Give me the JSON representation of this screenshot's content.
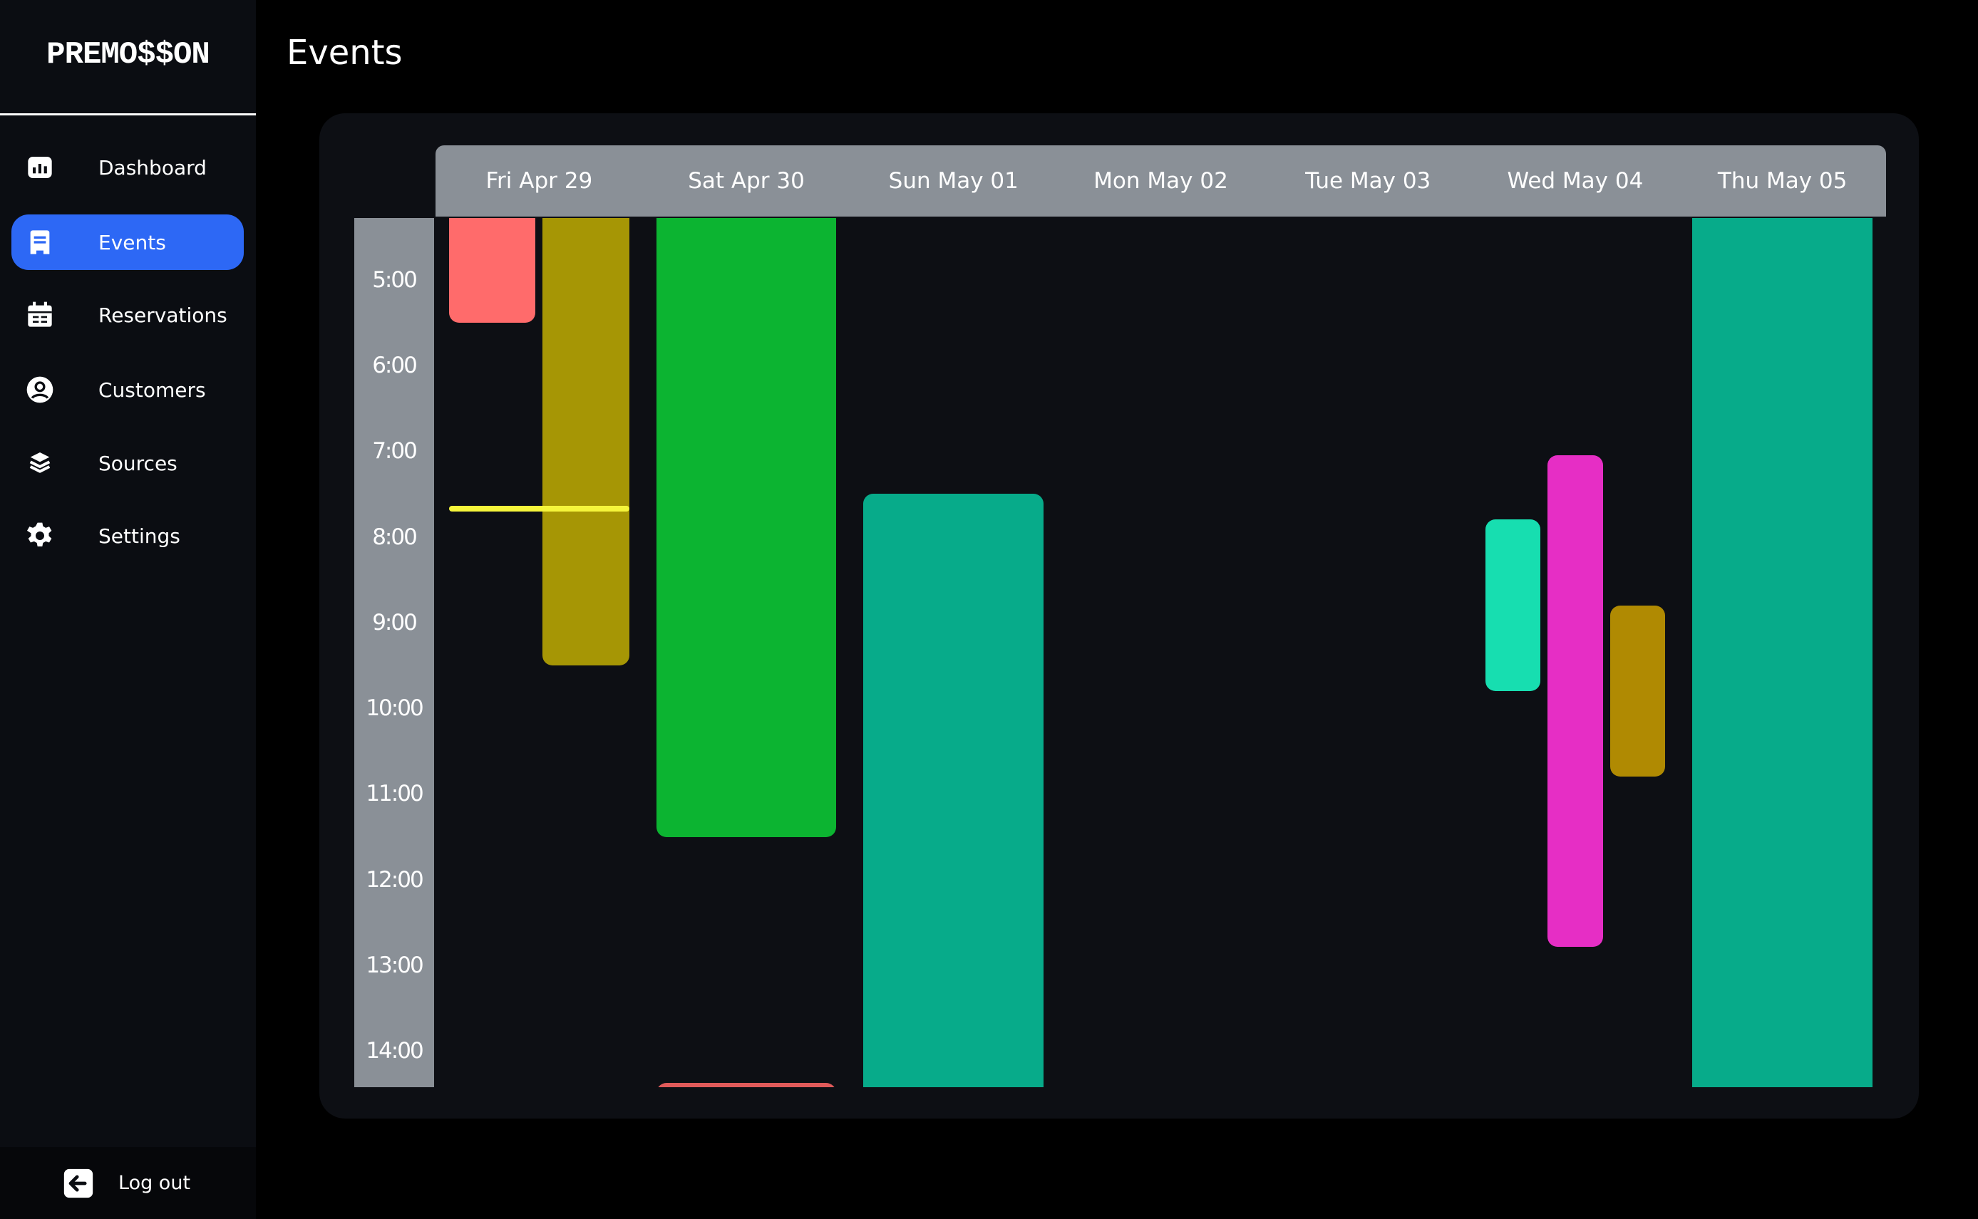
{
  "app": {
    "logo": "PREMO$$ON",
    "page_title": "Events"
  },
  "sidebar": {
    "items": [
      {
        "label": "Dashboard",
        "icon": "bar-chart-icon",
        "active": false
      },
      {
        "label": "Events",
        "icon": "events-icon",
        "active": true
      },
      {
        "label": "Reservations",
        "icon": "calendar-icon",
        "active": false
      },
      {
        "label": "Customers",
        "icon": "user-circle-icon",
        "active": false
      },
      {
        "label": "Sources",
        "icon": "layers-icon",
        "active": false
      },
      {
        "label": "Settings",
        "icon": "gear-icon",
        "active": false
      }
    ],
    "logout": "Log out"
  },
  "calendar": {
    "days": [
      "Fri Apr 29",
      "Sat Apr 30",
      "Sun May 01",
      "Mon May 02",
      "Tue May 03",
      "Wed May 04",
      "Thu May 05"
    ],
    "hours": [
      "5:00",
      "6:00",
      "7:00",
      "8:00",
      "9:00",
      "10:00",
      "11:00",
      "12:00",
      "13:00",
      "14:00"
    ],
    "visible_range_hours": [
      4.28,
      14.43
    ],
    "events": [
      {
        "day": 0,
        "start": 4.0,
        "end": 5.5,
        "color": "#ff6b6b",
        "lane": 0,
        "lanes": 2
      },
      {
        "day": 0,
        "start": 4.0,
        "end": 9.5,
        "color": "#a69605",
        "lane": 1,
        "lanes": 2
      },
      {
        "day": 1,
        "start": 4.0,
        "end": 11.5,
        "color": "#0cb431",
        "lane": 0,
        "lanes": 1
      },
      {
        "day": 1,
        "start": 14.37,
        "end": 15.5,
        "color": "#e05a5a",
        "lane": 0,
        "lanes": 1
      },
      {
        "day": 2,
        "start": 7.5,
        "end": 15.0,
        "color": "#07ab8a",
        "lane": 0,
        "lanes": 1
      },
      {
        "day": 5,
        "start": 7.8,
        "end": 9.8,
        "color": "#17deb0",
        "lane": 0,
        "lanes": 3
      },
      {
        "day": 5,
        "start": 7.05,
        "end": 12.78,
        "color": "#e62ec5",
        "lane": 1,
        "lanes": 3
      },
      {
        "day": 5,
        "start": 8.8,
        "end": 10.8,
        "color": "#b08a02",
        "lane": 2,
        "lanes": 3
      },
      {
        "day": 6,
        "start": 4.0,
        "end": 15.0,
        "color": "#07ab8a",
        "lane": 0,
        "lanes": 1
      }
    ],
    "current_time_marker": {
      "day": 0,
      "time": 7.67,
      "color": "#f5f53b"
    }
  }
}
